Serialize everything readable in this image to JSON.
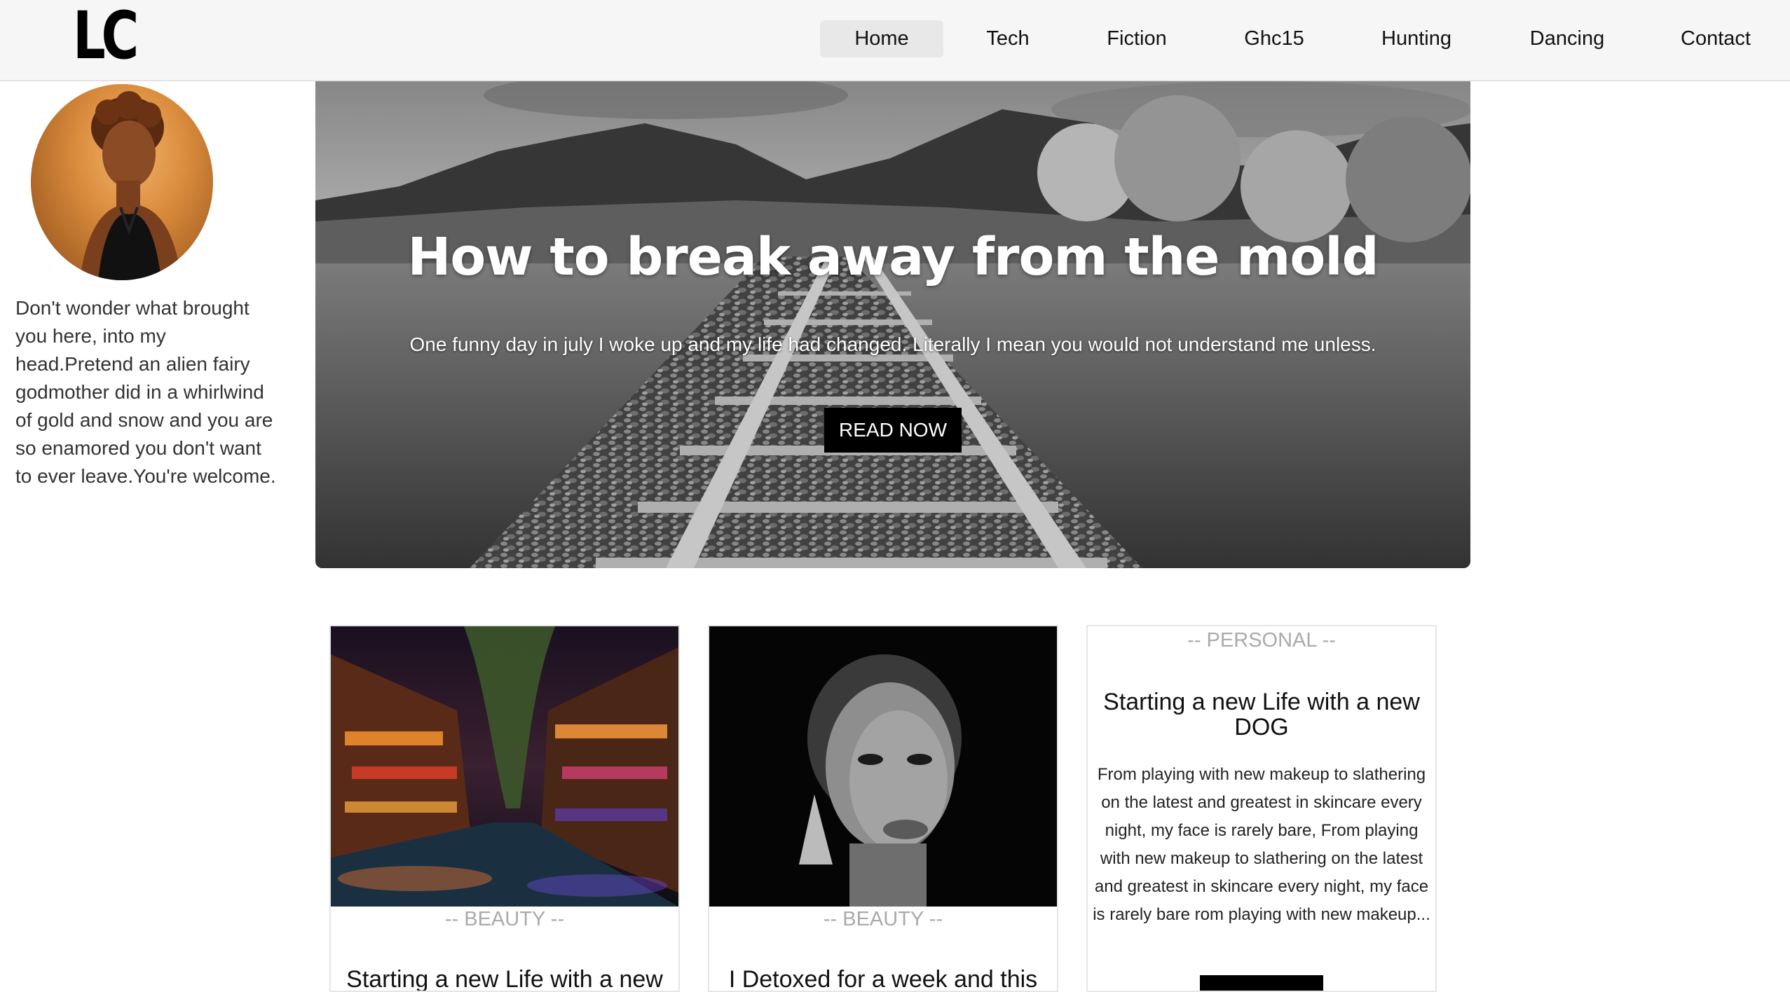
{
  "brand": {
    "logo_text": "LC"
  },
  "nav": {
    "items": [
      {
        "label": "Home",
        "active": true
      },
      {
        "label": "Tech"
      },
      {
        "label": "Fiction"
      },
      {
        "label": "Ghc15"
      },
      {
        "label": "Hunting"
      },
      {
        "label": "Dancing"
      },
      {
        "label": "Contact"
      }
    ]
  },
  "sidebar": {
    "bio": "Don't wonder what brought you here, into my head.Pretend an alien fairy godmother did in a whirlwind of gold and snow and you are so enamored you don't want to ever leave.You're welcome."
  },
  "hero": {
    "title": "How to break away from the mold",
    "subtitle": "One funny day in july I woke up and my life had changed. Literally I mean you would not understand me unless.",
    "button_label": "READ NOW"
  },
  "cards": [
    {
      "category": "-- BEAUTY --",
      "title": "Starting a new Life with a new"
    },
    {
      "category": "-- BEAUTY --",
      "title": "I Detoxed for a week and this"
    },
    {
      "category": "-- PERSONAL --",
      "title": "Starting a new Life with a new DOG",
      "text": "From playing with new makeup to slathering on the latest and greatest in skincare every night, my face is rarely bare, From playing with new makeup to slathering on the latest and greatest in skincare every night, my face is rarely bare rom playing with new makeup..."
    }
  ],
  "colors": {
    "header_bg": "#f6f6f6",
    "active_nav_bg": "#e8e8e8",
    "button_bg": "#000000",
    "category_text": "#aaaaaa"
  }
}
